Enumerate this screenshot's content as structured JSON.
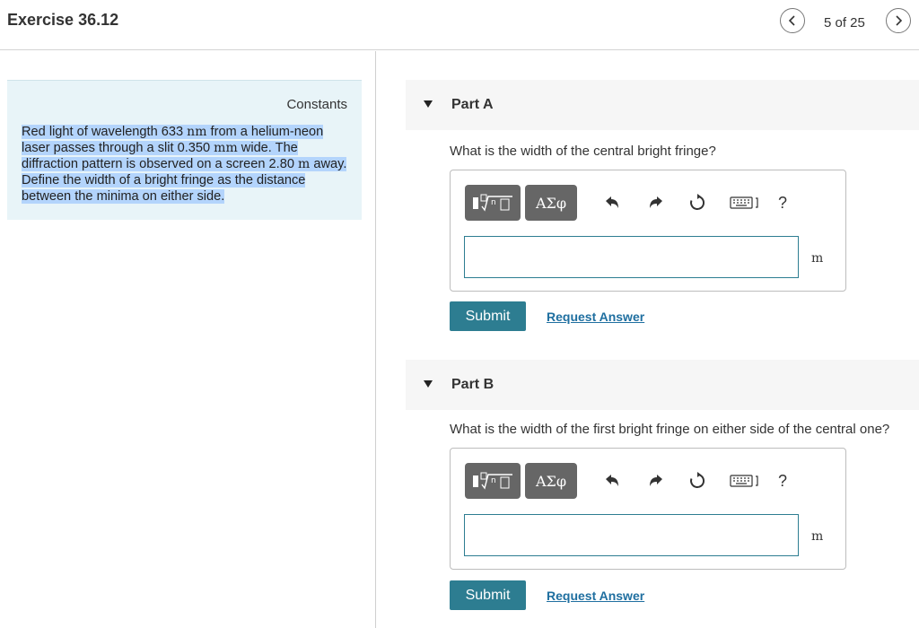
{
  "header": {
    "title": "Exercise 36.12",
    "counter": "5 of 25",
    "prev_icon": "chevron-left-icon",
    "next_icon": "chevron-right-icon"
  },
  "sidebar": {
    "constants_label": "Constants",
    "problem": {
      "t1": "Red light of wavelength 633 ",
      "u1": "nm",
      "t2": " from a helium-neon laser passes through a slit 0.350 ",
      "u2": "mm",
      "t3": " wide. The diffraction pattern is observed on a screen 2.80 ",
      "u3": "m",
      "t4": " away. Define the width of a bright fringe as the distance between the minima on either side."
    },
    "highlight_color": "#b3d4fc",
    "background_color": "#e8f4f8"
  },
  "parts": [
    {
      "label": "Part A",
      "question": "What is the width of the central bright fringe?",
      "answer_value": "",
      "unit": "m",
      "toolbar": {
        "template_icon": "template-sqrt-icon",
        "greek_label": "ΑΣφ",
        "undo_icon": "undo-icon",
        "redo_icon": "redo-icon",
        "reset_icon": "reset-icon",
        "keyboard_icon": "keyboard-icon",
        "help_label": "?"
      },
      "submit_label": "Submit",
      "request_label": "Request Answer"
    },
    {
      "label": "Part B",
      "question": "What is the width of the first bright fringe on either side of the central one?",
      "answer_value": "",
      "unit": "m",
      "toolbar": {
        "template_icon": "template-sqrt-icon",
        "greek_label": "ΑΣφ",
        "undo_icon": "undo-icon",
        "redo_icon": "redo-icon",
        "reset_icon": "reset-icon",
        "keyboard_icon": "keyboard-icon",
        "help_label": "?"
      },
      "submit_label": "Submit",
      "request_label": "Request Answer"
    }
  ],
  "colors": {
    "accent": "#2d7d91",
    "link": "#1f6fa0",
    "tool_bg": "#666666"
  }
}
